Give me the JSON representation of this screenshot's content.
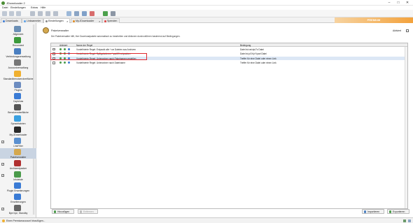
{
  "window": {
    "title": "JDownloader 2",
    "minimize": "–",
    "maximize": "□",
    "close": "✕"
  },
  "menu": [
    "Datei",
    "Einstellungen",
    "Extras",
    "Hilfe"
  ],
  "tabs": [
    {
      "label": "Downloads",
      "color": "#3a7bd5"
    },
    {
      "label": "Linksammler",
      "color": "#5aa0e6"
    },
    {
      "label": "Einstellungen",
      "color": "#888888",
      "closable": true,
      "active": true
    },
    {
      "label": "My.JDownloader",
      "color": "#e08a1e",
      "closable": true
    },
    {
      "label": "Spenden",
      "color": "#e04040"
    }
  ],
  "promo": "PREMIUM",
  "sidebar": [
    {
      "label": "Allgemein",
      "icon": "gear-icon",
      "color": "#6b8fb5"
    },
    {
      "label": "Reconnect",
      "icon": "reconnect-icon",
      "color": "#3c9a3c"
    },
    {
      "label": "Verbindungsverwaltung",
      "icon": "network-icon",
      "color": "#4a7fc0"
    },
    {
      "label": "Accountverwaltung",
      "icon": "account-icon",
      "color": "#777"
    },
    {
      "label": "Standardbenutzeroberfläche",
      "icon": "ui-icon",
      "color": "#f0b030"
    },
    {
      "label": "Plugins",
      "icon": "plugin-icon",
      "color": "#6c8cc0"
    },
    {
      "label": "Captchas",
      "icon": "captcha-icon",
      "color": "#3a7bd5"
    },
    {
      "label": "Benutzeroberfläche",
      "icon": "paint-icon",
      "color": "#555"
    },
    {
      "label": "Sprachfabrien",
      "icon": "speech-icon",
      "color": "#3aa0e0"
    },
    {
      "label": "My.JDownloader",
      "icon": "myjd-icon",
      "color": "#2a2a2a"
    },
    {
      "label": "LinkFilter",
      "icon": "filter-icon",
      "color": "#5a90d0",
      "check": true
    },
    {
      "label": "Paketverwalter",
      "icon": "package-icon",
      "color": "#d4a84e",
      "selected": true
    },
    {
      "label": "Archiventpacker",
      "icon": "archive-icon",
      "color": "#b03030",
      "check": true
    },
    {
      "label": "Infoleiste",
      "icon": "info-icon",
      "color": "#4a9a4a",
      "check": true
    },
    {
      "label": "Plugin Erweiterungen",
      "icon": "extension-icon",
      "color": "#3a7bd5"
    },
    {
      "label": "Erweiterungen",
      "icon": "puzzle-icon",
      "color": "#3a7bd5"
    },
    {
      "label": "Bye bye, Standby",
      "icon": "standby-icon",
      "color": "#666",
      "check": true
    }
  ],
  "main": {
    "title": "Paketverwalter",
    "description": "Der Paketverwalter hilft, Ihre Downloadpakete automatisch zu bearbeiten und Aktionen durchzuführen basierend auf Bedingungen.",
    "enabled_label": "Aktiviert",
    "columns": [
      "",
      "Aktiviert",
      "Name der Regel",
      "Bedingung"
    ],
    "rows": [
      {
        "name": "Vordefinierte Regel: Entpackt alle *.rar Dateien aus Archiven",
        "condition": "Datei ist rar/zip/7z Datei",
        "checked": true
      },
      {
        "name": "Vordefinierte Regel: Splitgeladenes *.part01 entpacken",
        "condition": "Datei ist pXX/pY/part Datei",
        "checked": true
      },
      {
        "name": "Vordefinierte Regel: Unterordner nach Paketnamen erstellen",
        "condition": "Treffer für eine Datei oder einen Link",
        "checked": true,
        "selected": true
      },
      {
        "name": "Vordefinierte Regel: Unterordner nach Dateiname",
        "condition": "Treffer für eine Datei oder einen Link",
        "checked": true
      }
    ],
    "add_label": "Hinzufügen",
    "remove_label": "Entfernen",
    "import_label": "Importieren",
    "export_label": "Exportieren"
  },
  "status": {
    "left": "Einen Premiumaccount hinzufügen..."
  }
}
